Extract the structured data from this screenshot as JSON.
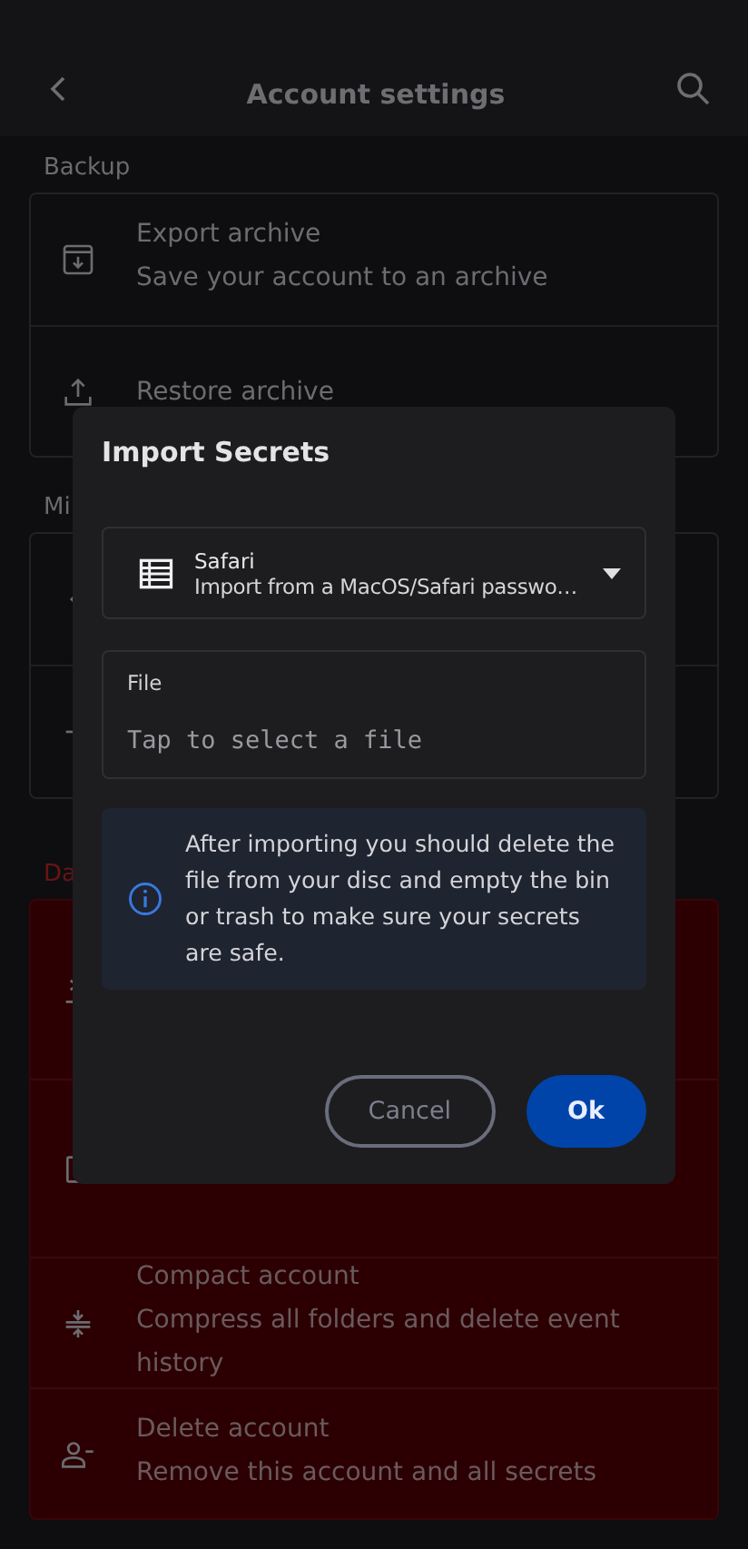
{
  "header": {
    "title": "Account settings"
  },
  "sections": [
    {
      "label": "Backup",
      "kind": "normal",
      "rows": [
        {
          "title": "Export archive",
          "subtitle": "Save your account to an archive"
        },
        {
          "title": "Restore archive"
        }
      ]
    },
    {
      "label": "Mi",
      "kind": "normal",
      "rows": [
        {},
        {}
      ]
    },
    {
      "label": "Da",
      "kind": "danger",
      "rows": [
        {},
        {},
        {
          "title": "Compact account",
          "subtitle": "Compress all folders and delete event history"
        },
        {
          "title": "Delete account",
          "subtitle": "Remove this account and all secrets"
        }
      ]
    }
  ],
  "dialog": {
    "title": "Import Secrets",
    "format": {
      "name": "Safari",
      "description": "Import from a MacOS/Safari passwo…"
    },
    "file": {
      "label": "File",
      "placeholder": "Tap to select a file"
    },
    "info": "After importing you should delete the file from your disc and empty the bin or trash to make sure your secrets are safe.",
    "buttons": [
      {
        "label": "Cancel",
        "kind": "outline"
      },
      {
        "label": "Ok",
        "kind": "primary"
      }
    ]
  }
}
